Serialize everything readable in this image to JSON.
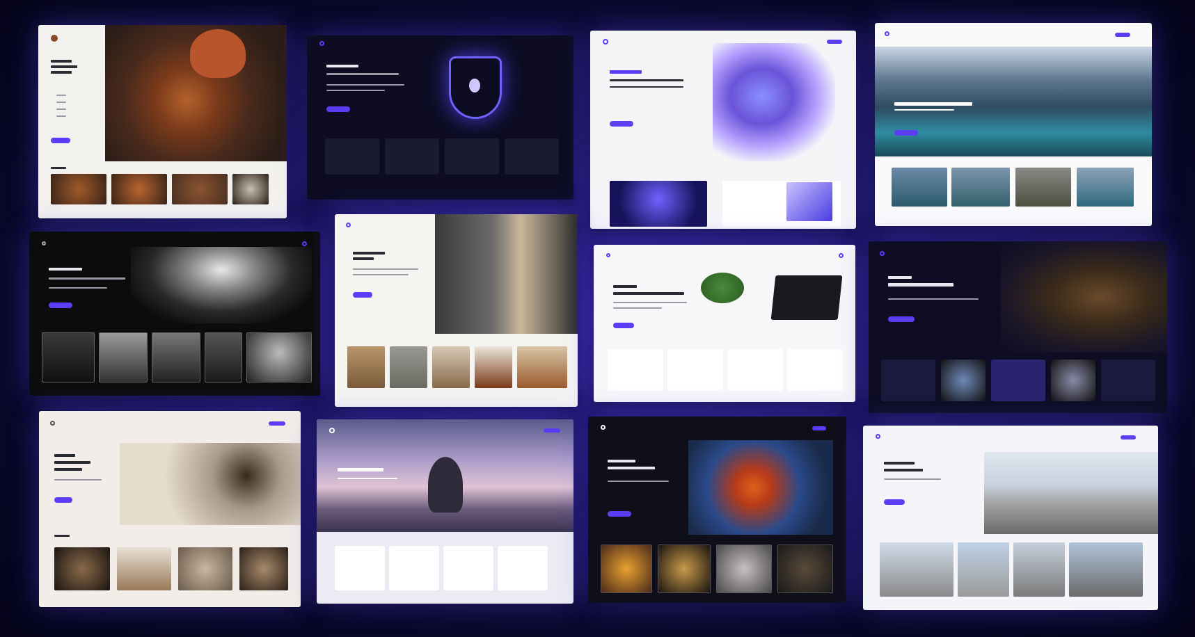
{
  "collage": {
    "cards": [
      {
        "name": "food-site",
        "theme": "light",
        "buttons": [
          "cta"
        ]
      },
      {
        "name": "security-site",
        "theme": "dark",
        "buttons": [
          "cta"
        ]
      },
      {
        "name": "ai-site",
        "theme": "light",
        "buttons": [
          "cta"
        ]
      },
      {
        "name": "travel-site",
        "theme": "light",
        "buttons": [
          "cta"
        ]
      },
      {
        "name": "mountain-site",
        "theme": "dark",
        "buttons": [
          "cta"
        ]
      },
      {
        "name": "fashion-site",
        "theme": "light",
        "buttons": [
          "cta"
        ]
      },
      {
        "name": "workspace-site",
        "theme": "light",
        "buttons": [
          "cta"
        ]
      },
      {
        "name": "library-site",
        "theme": "dark",
        "buttons": [
          "cta"
        ]
      },
      {
        "name": "journal-site",
        "theme": "light",
        "buttons": [
          "cta"
        ]
      },
      {
        "name": "yoga-site",
        "theme": "light",
        "buttons": [
          "cta"
        ]
      },
      {
        "name": "art-site",
        "theme": "dark",
        "buttons": [
          "cta"
        ]
      },
      {
        "name": "architecture-site",
        "theme": "light",
        "buttons": [
          "cta"
        ]
      }
    ],
    "accent": "#5b3df5"
  }
}
